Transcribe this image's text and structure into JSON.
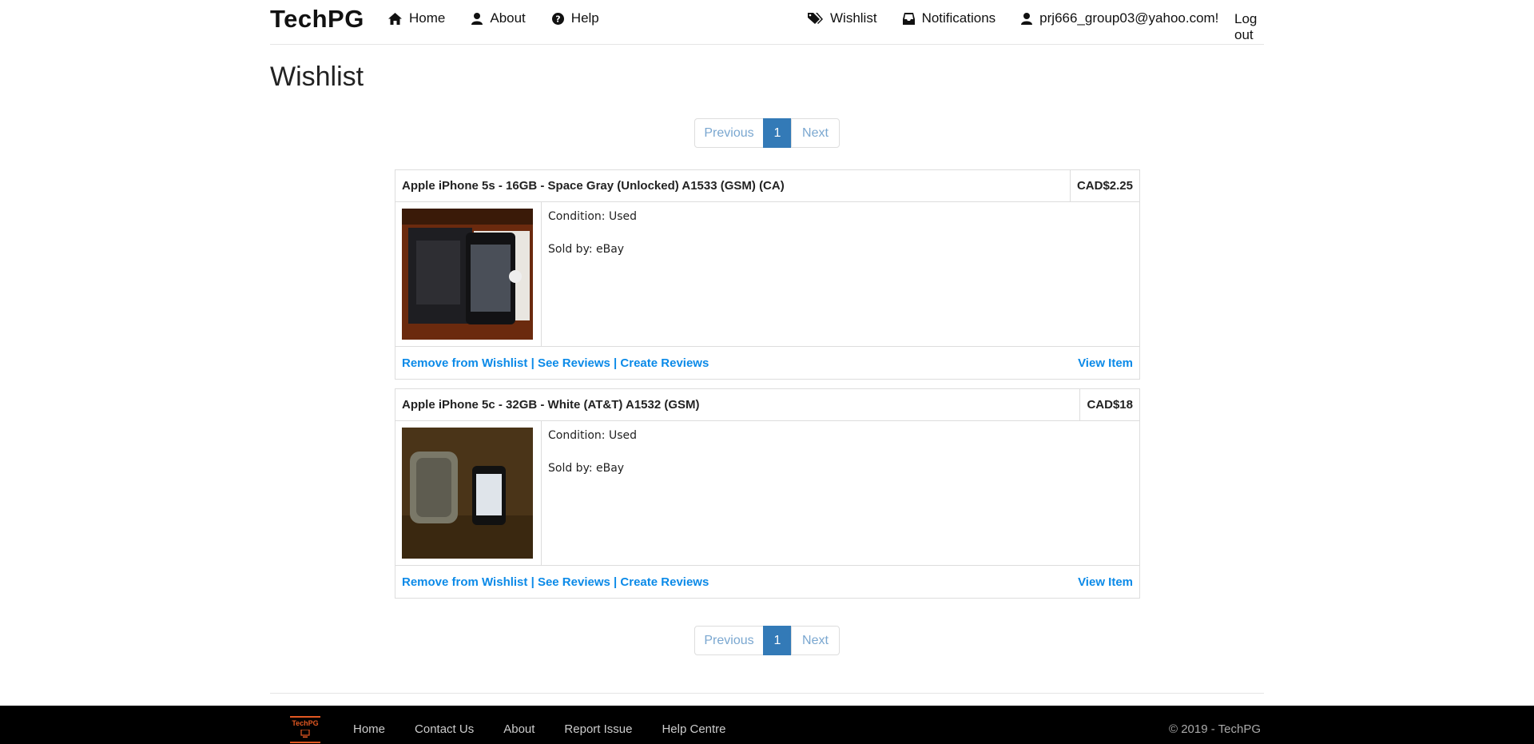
{
  "header": {
    "brand": "TechPG",
    "nav_left": [
      {
        "label": "Home",
        "icon": "home-icon"
      },
      {
        "label": "About",
        "icon": "user-icon"
      },
      {
        "label": "Help",
        "icon": "question-circle-icon"
      }
    ],
    "nav_right": [
      {
        "label": "Wishlist",
        "icon": "tags-icon"
      },
      {
        "label": "Notifications",
        "icon": "inbox-icon"
      },
      {
        "label": "prj666_group03@yahoo.com!",
        "icon": "user-icon"
      }
    ],
    "logout": "Log out"
  },
  "page_title": "Wishlist",
  "pagination": {
    "previous": "Previous",
    "current": "1",
    "next": "Next"
  },
  "items": [
    {
      "title": "Apple iPhone 5s - 16GB - Space Gray (Unlocked) A1533 (GSM) (CA)",
      "price": "CAD$2.25",
      "condition": "Condition: Used",
      "seller": "Sold by: eBay",
      "remove": "Remove from Wishlist",
      "see_reviews": "See Reviews",
      "create_reviews": "Create Reviews",
      "view": "View Item",
      "separator": " | "
    },
    {
      "title": "Apple iPhone 5c - 32GB - White (AT&T) A1532 (GSM)",
      "price": "CAD$18",
      "condition": "Condition: Used",
      "seller": "Sold by: eBay",
      "remove": "Remove from Wishlist",
      "see_reviews": "See Reviews",
      "create_reviews": "Create Reviews",
      "view": "View Item",
      "separator": " | "
    }
  ],
  "footer": {
    "logo_text": "TechPG",
    "links": [
      "Home",
      "Contact Us",
      "About",
      "Report Issue",
      "Help Centre"
    ],
    "copyright": "© 2019 - TechPG"
  },
  "colors": {
    "link": "#0b8ae8",
    "pagination_active": "#337ab7",
    "footer_bg": "#000000",
    "logo_accent": "#e25822"
  }
}
